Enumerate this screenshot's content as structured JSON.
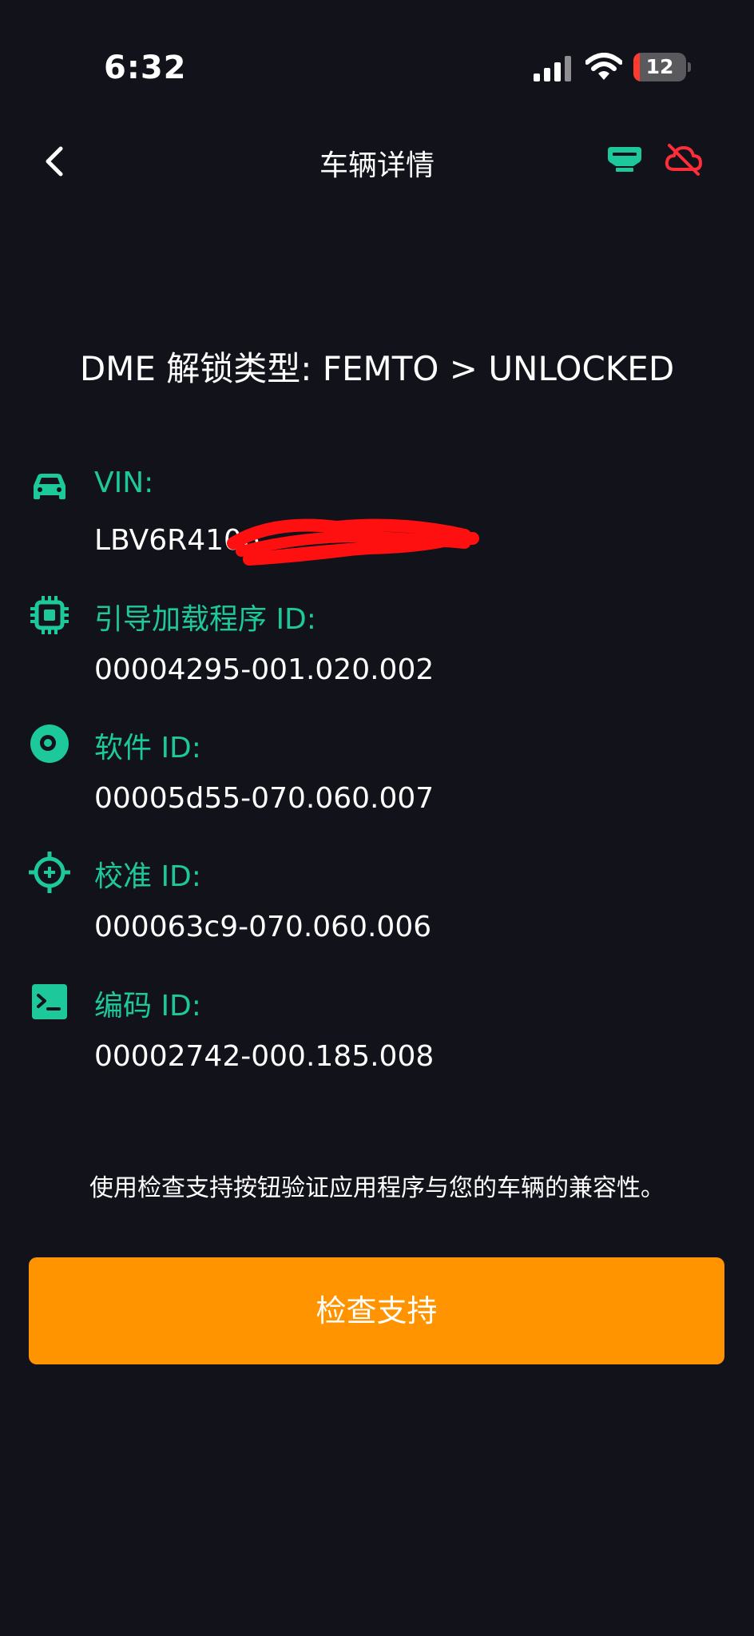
{
  "status_bar": {
    "time": "6:32",
    "battery_level": "12"
  },
  "header": {
    "title": "车辆详情"
  },
  "unlock_type": "DME 解锁类型: FEMTO > UNLOCKED",
  "vehicle_info": [
    {
      "icon": "car-icon",
      "label": "VIN:",
      "value": "LBV6R4106"
    },
    {
      "icon": "chip-icon",
      "label": "引导加载程序 ID:",
      "value": "00004295-001.020.002"
    },
    {
      "icon": "disc-icon",
      "label": "软件 ID:",
      "value": "00005d55-070.060.007"
    },
    {
      "icon": "crosshair-icon",
      "label": "校准 ID:",
      "value": "000063c9-070.060.006"
    },
    {
      "icon": "terminal-icon",
      "label": "编码 ID:",
      "value": "00002742-000.185.008"
    }
  ],
  "hint": "使用检查支持按钮验证应用程序与您的车辆的兼容性。",
  "check_button_label": "检查支持",
  "colors": {
    "background": "#11121a",
    "accent_green": "#1dc99a",
    "button_orange": "#ff9400",
    "cloud_red": "#ff2d3a"
  }
}
